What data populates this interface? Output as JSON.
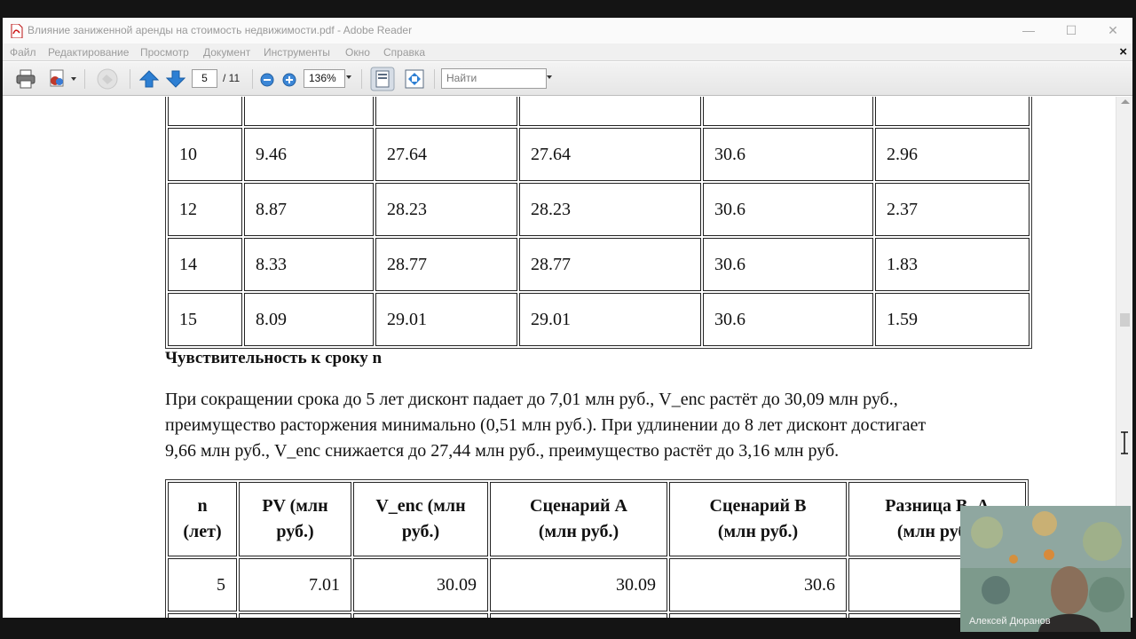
{
  "window": {
    "title": "Влияние заниженной аренды на стоимость недвижимости.pdf - Adobe Reader",
    "controls": {
      "minimize": "—",
      "maximize": "☐",
      "close": "✕"
    }
  },
  "menu": {
    "items": [
      "Файл",
      "Редактирование",
      "Просмотр",
      "Документ",
      "Инструменты",
      "Окно",
      "Справка"
    ],
    "doc_close": "×"
  },
  "toolbar": {
    "page_current": "5",
    "page_total": "/ 11",
    "zoom": "136%",
    "find_placeholder": "Найти",
    "icons": [
      "print-icon",
      "create-pdf-icon",
      "collaborate-icon",
      "previous-page-icon",
      "next-page-icon",
      "zoom-out-icon",
      "zoom-in-icon",
      "fit-page-icon",
      "fit-width-icon"
    ]
  },
  "document": {
    "table1": {
      "rows": [
        [
          "10",
          "9.46",
          "27.64",
          "27.64",
          "30.6",
          "2.96"
        ],
        [
          "12",
          "8.87",
          "28.23",
          "28.23",
          "30.6",
          "2.37"
        ],
        [
          "14",
          "8.33",
          "28.77",
          "28.77",
          "30.6",
          "1.83"
        ],
        [
          "15",
          "8.09",
          "29.01",
          "29.01",
          "30.6",
          "1.59"
        ]
      ]
    },
    "heading": "Чувствительность к сроку n",
    "paragraph_lines": [
      "При сокращении срока до 5 лет дисконт падает до 7,01 млн руб., V_enc растёт до 30,09 млн руб.,",
      "преимущество расторжения минимально (0,51 млн руб.). При удлинении до 8 лет дисконт достигает",
      "9,66 млн руб., V_enc снижается до 27,44 млн руб., преимущество растёт до 3,16 млн руб."
    ],
    "table2": {
      "headers": [
        [
          "n",
          "(лет)"
        ],
        [
          "PV (млн",
          "руб.)"
        ],
        [
          "V_enc (млн",
          "руб.)"
        ],
        [
          "Сценарий A",
          "(млн руб.)"
        ],
        [
          "Сценарий B",
          "(млн руб.)"
        ],
        [
          "Разница B–A",
          "(млн руб.)"
        ]
      ],
      "rows": [
        [
          "5",
          "7.01",
          "30.09",
          "30.09",
          "30.6",
          ""
        ]
      ]
    }
  },
  "webcam": {
    "participant_name": "Алексей Дюранов"
  }
}
